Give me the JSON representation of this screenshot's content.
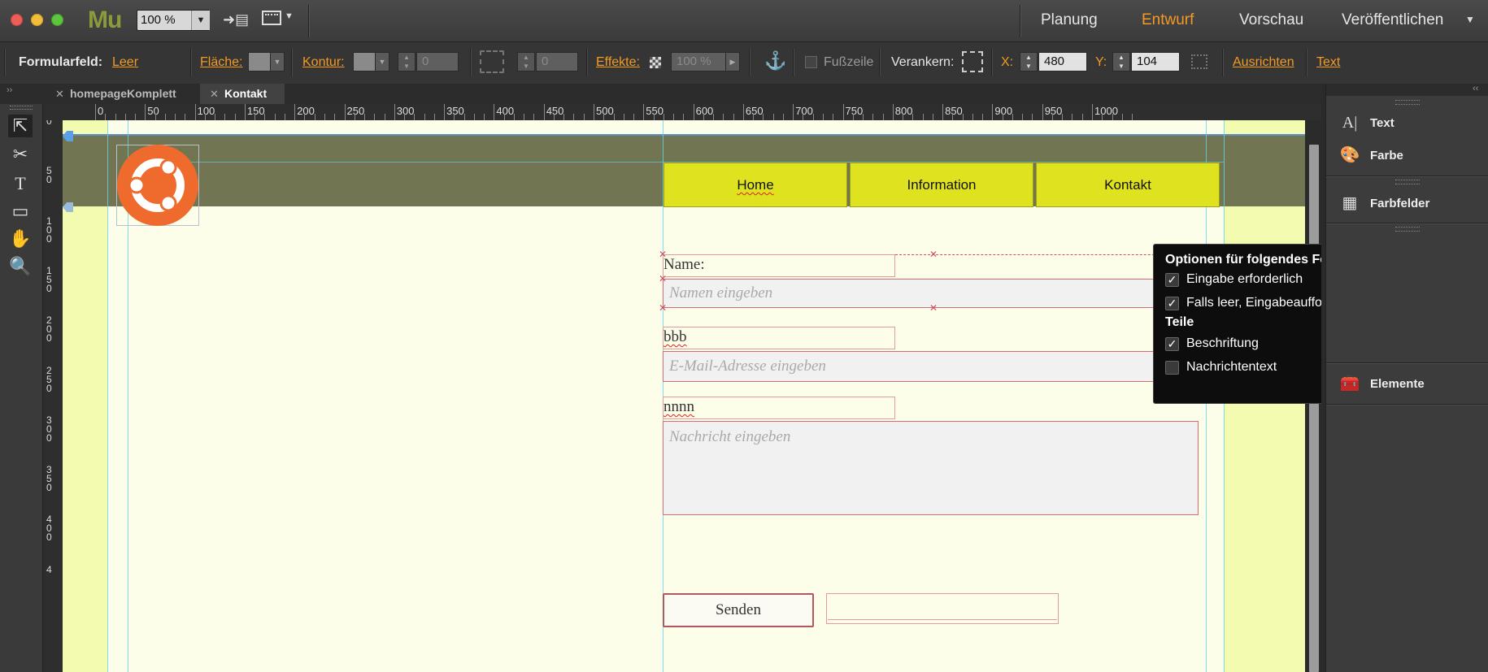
{
  "app": {
    "logo": "Mu",
    "zoom": "100 %"
  },
  "modes": {
    "planung": "Planung",
    "entwurf": "Entwurf",
    "vorschau": "Vorschau",
    "veroeffentlichen": "Veröffentlichen"
  },
  "controlbar": {
    "formularfeld_label": "Formularfeld:",
    "formularfeld_value": "Leer",
    "flaeche": "Fläche:",
    "kontur": "Kontur:",
    "kontur_value": "0",
    "corner_value": "0",
    "effekte": "Effekte:",
    "effekte_value": "100 %",
    "fusszeile": "Fußzeile",
    "verankern": "Verankern:",
    "x_label": "X:",
    "x_value": "480",
    "y_label": "Y:",
    "y_value": "104",
    "ausrichten": "Ausrichten",
    "text": "Text"
  },
  "tabs": [
    {
      "label": "homepageKomplett"
    },
    {
      "label": "Kontakt"
    }
  ],
  "ruler_h": [
    "0",
    "50",
    "100",
    "150",
    "200",
    "250",
    "300",
    "350",
    "400",
    "450",
    "500",
    "550",
    "600",
    "650",
    "700",
    "750",
    "800",
    "850",
    "900",
    "950",
    "1000"
  ],
  "ruler_v": [
    "0",
    "50",
    "100",
    "150",
    "200",
    "250",
    "300",
    "350",
    "400",
    "4"
  ],
  "nav": {
    "home": "Home",
    "information": "Information",
    "kontakt": "Kontakt"
  },
  "form": {
    "name_label": "Name:",
    "name_placeholder": "Namen eingeben",
    "email_label": "bbb",
    "email_placeholder": "E-Mail-Adresse eingeben",
    "message_label": "nnnn",
    "message_placeholder": "Nachricht eingeben",
    "send": "Senden"
  },
  "popup": {
    "title": "Optionen für folgendes Feld: Name",
    "option1": "Eingabe erforderlich",
    "option2": "Falls leer, Eingabeaufforderungstext anzeigen",
    "parts_title": "Teile",
    "part1": "Beschriftung",
    "part2": "Nachrichtentext",
    "checked": "✓"
  },
  "panels": {
    "text": "Text",
    "farbe": "Farbe",
    "farbfelder": "Farbfelder",
    "elemente": "Elemente"
  },
  "colors": {
    "accent": "#f39a24",
    "nav_button": "#dfe21e",
    "header": "#727552",
    "logo": "#ef6b2d",
    "canvas": "#fdfee9"
  }
}
